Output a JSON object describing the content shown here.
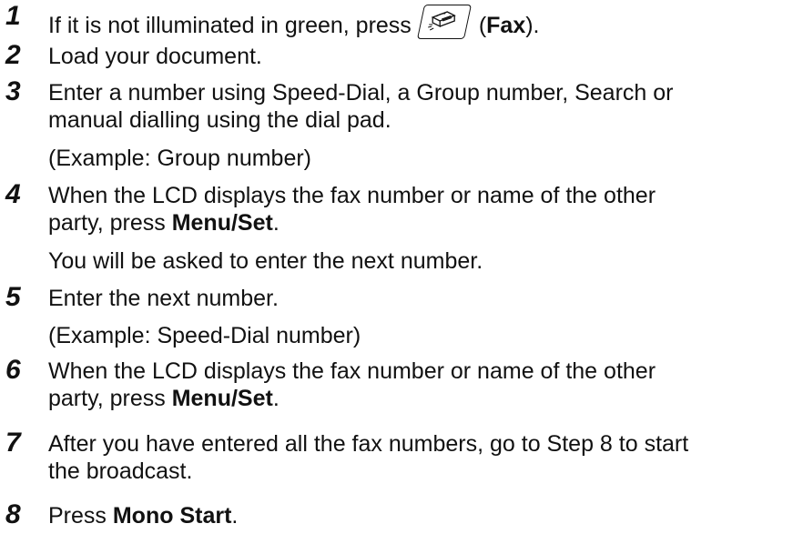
{
  "steps": [
    {
      "num": "1",
      "pre": "If it is not illuminated in green, press",
      "key_icon": "fax-key-icon",
      "paren_open": "(",
      "bold": "Fax",
      "paren_close": ")."
    },
    {
      "num": "2",
      "text": "Load your document."
    },
    {
      "num": "3",
      "line1": "Enter a number using Speed-Dial, a Group number, Search or",
      "line2": "manual dialling using the dial pad.",
      "sub": "(Example: Group number)"
    },
    {
      "num": "4",
      "line1": "When the LCD displays the fax number or name of the other",
      "line2_pre": "party, press ",
      "line2_bold": "Menu/Set",
      "line2_post": ".",
      "sub": "You will be asked to enter the next number."
    },
    {
      "num": "5",
      "text": "Enter the next number.",
      "sub": "(Example: Speed-Dial number)"
    },
    {
      "num": "6",
      "line1": "When the LCD displays the fax number or name of the other",
      "line2_pre": "party, press ",
      "line2_bold": "Menu/Set",
      "line2_post": "."
    },
    {
      "num": "7",
      "line1": "After you have entered all the fax numbers, go to Step 8 to start",
      "line2": "the broadcast."
    },
    {
      "num": "8",
      "pre": "Press ",
      "bold": "Mono Start",
      "post": "."
    }
  ]
}
